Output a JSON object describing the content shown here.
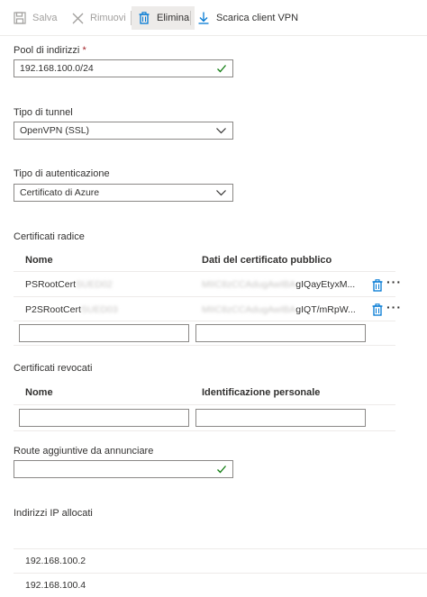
{
  "toolbar": {
    "save_label": "Salva",
    "remove_label": "Rimuovi",
    "delete_label": "Elimina",
    "download_label": "Scarica client VPN"
  },
  "address_pool": {
    "label": "Pool di indirizzi",
    "required_mark": "*",
    "value": "192.168.100.0/24"
  },
  "tunnel_type": {
    "label": "Tipo di tunnel",
    "value": "OpenVPN (SSL)"
  },
  "auth_type": {
    "label": "Tipo di autenticazione",
    "value": "Certificato di Azure"
  },
  "root_certs": {
    "label": "Certificati radice",
    "col_name": "Nome",
    "col_data": "Dati del certificato pubblico",
    "rows": [
      {
        "name": "PSRootCert",
        "name_hidden": "SUED02",
        "data_hidden": "MIIC8zCCAdugAwIBA",
        "data_visible": "gIQayEtyxM..."
      },
      {
        "name": "P2SRootCert",
        "name_hidden": "SUED03",
        "data_hidden": "MIIC8zCCAdugAwIBA",
        "data_visible": "gIQT/mRpW..."
      }
    ]
  },
  "revoked_certs": {
    "label": "Certificati revocati",
    "col_name": "Nome",
    "col_thumbprint": "Identificazione personale"
  },
  "additional_routes": {
    "label": "Route aggiuntive da annunciare"
  },
  "allocated_ips": {
    "label": "Indirizzi IP allocati",
    "items": [
      "192.168.100.2",
      "192.168.100.4"
    ]
  },
  "colors": {
    "accent": "#0078d4",
    "valid": "#107c10",
    "disabled": "#a19f9d"
  }
}
